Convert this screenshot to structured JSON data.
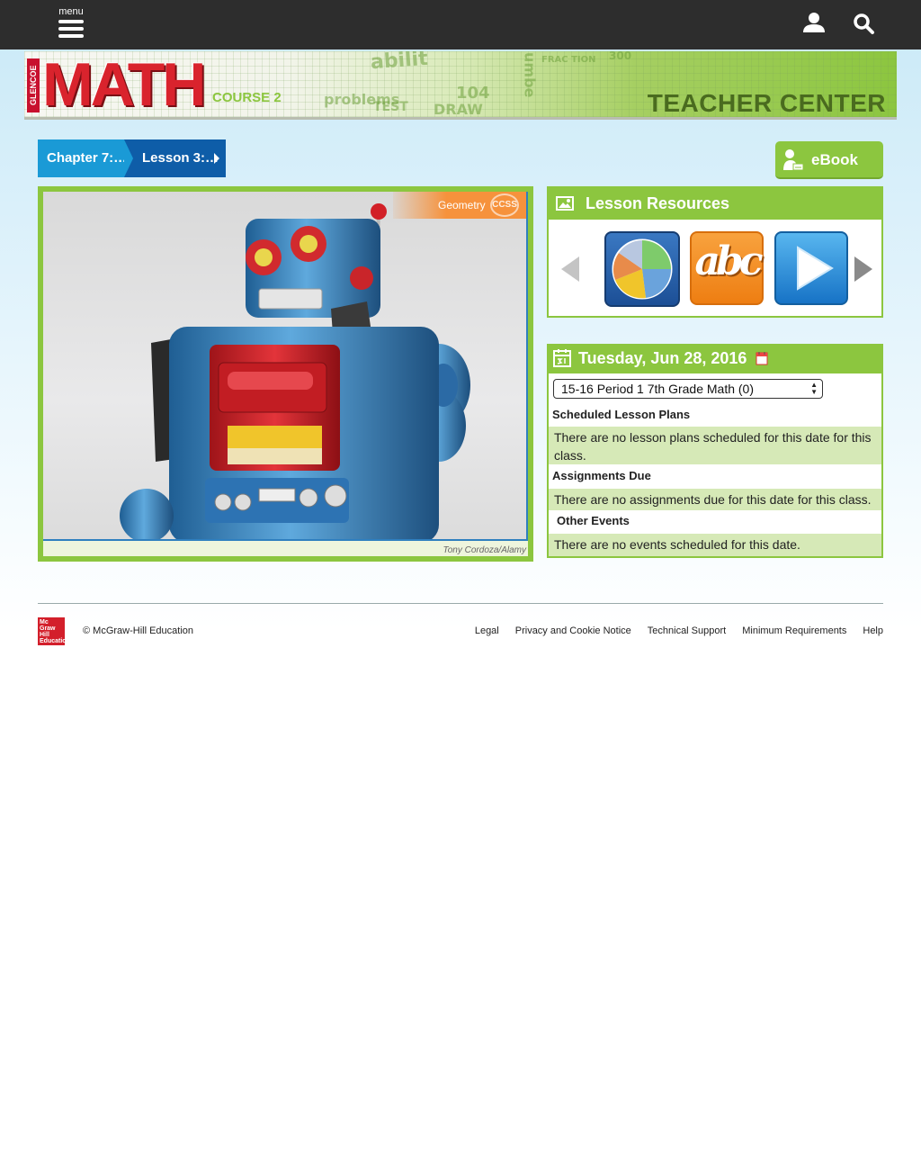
{
  "topbar": {
    "menu_label": "menu",
    "icons": [
      "hamburger-icon",
      "user-icon",
      "search-icon"
    ]
  },
  "banner": {
    "publisher_tag": "GLENCOE",
    "title": "MATH",
    "course": "COURSE 2",
    "section": "TEACHER CENTER",
    "doodles": [
      "abilit",
      "FRAC TION",
      "problems",
      "104",
      "DRAW",
      "Numbe",
      "TEST",
      "300"
    ]
  },
  "breadcrumb": {
    "chapter": "Chapter 7:…",
    "lesson": "Lesson 3:…"
  },
  "ebook": {
    "label": "eBook"
  },
  "photo": {
    "tag": "Geometry",
    "badge": "CCSS",
    "credit": "Tony Cordoza/Alamy"
  },
  "resources": {
    "title": "Lesson Resources",
    "items": [
      {
        "icon": "pie-chart-icon"
      },
      {
        "icon": "abc-icon",
        "text": "abc"
      },
      {
        "icon": "play-icon"
      }
    ]
  },
  "calendar": {
    "date": "Tuesday, Jun 28, 2016",
    "class_selected": "15-16 Period 1 7th Grade Math (0)",
    "sections": [
      {
        "title": "Scheduled Lesson Plans",
        "body": "There are no lesson plans scheduled for this date for this class."
      },
      {
        "title": "Assignments Due",
        "body": "There are no assignments due for this date for this class."
      },
      {
        "title": "Other Events",
        "body": "There are no events scheduled for this date."
      }
    ]
  },
  "footer": {
    "logo_text": "Mc Graw Hill Education",
    "copyright": "© McGraw-Hill Education",
    "links": [
      "Legal",
      "Privacy and Cookie Notice",
      "Technical Support",
      "Minimum Requirements",
      "Help"
    ]
  },
  "colors": {
    "accent_green": "#8cc63f",
    "topbar": "#2d2d2d",
    "crumb_light": "#1a9ad6",
    "crumb_dark": "#0e5da8",
    "brand_red": "#d31f2b"
  }
}
